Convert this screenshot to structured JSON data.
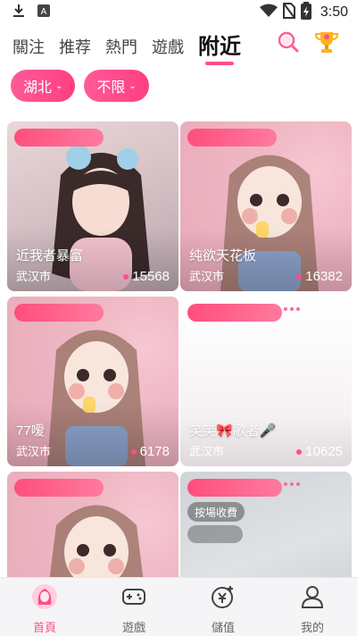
{
  "status_bar": {
    "time": "3:50",
    "icons": [
      "download-icon",
      "a-notification-icon",
      "wifi-icon",
      "no-sim-icon",
      "battery-charging-icon"
    ]
  },
  "tabs": [
    {
      "label": "關注",
      "active": false
    },
    {
      "label": "推荐",
      "active": false
    },
    {
      "label": "熱門",
      "active": false
    },
    {
      "label": "遊戲",
      "active": false
    },
    {
      "label": "附近",
      "active": true
    }
  ],
  "header_icons": [
    "search-icon",
    "trophy-icon"
  ],
  "filters": [
    {
      "label": "湖北"
    },
    {
      "label": "不限"
    }
  ],
  "cards": [
    {
      "name": "近我者暴富",
      "city": "武汉市",
      "popularity": "15568"
    },
    {
      "name": "纯欲天花板",
      "city": "武汉市",
      "popularity": "16382"
    },
    {
      "name": "77嗳",
      "city": "武汉市",
      "popularity": "6178"
    },
    {
      "name": "笑笑🎀歌者🎤",
      "city": "武汉市",
      "popularity": "10625"
    },
    {
      "name": "",
      "city": "",
      "popularity": ""
    },
    {
      "name": "",
      "city": "",
      "popularity": "",
      "badge": "按場收費"
    }
  ],
  "bottom_nav": [
    {
      "label": "首頁",
      "icon": "home-avatar-icon",
      "active": true
    },
    {
      "label": "遊戲",
      "icon": "gamepad-icon",
      "active": false
    },
    {
      "label": "儲值",
      "icon": "yuan-recharge-icon",
      "active": false
    },
    {
      "label": "我的",
      "icon": "profile-icon",
      "active": false
    }
  ],
  "colors": {
    "accent": "#ff4d8d",
    "chip": "#ff4f8e",
    "nav_bg": "#f5f5f7"
  }
}
